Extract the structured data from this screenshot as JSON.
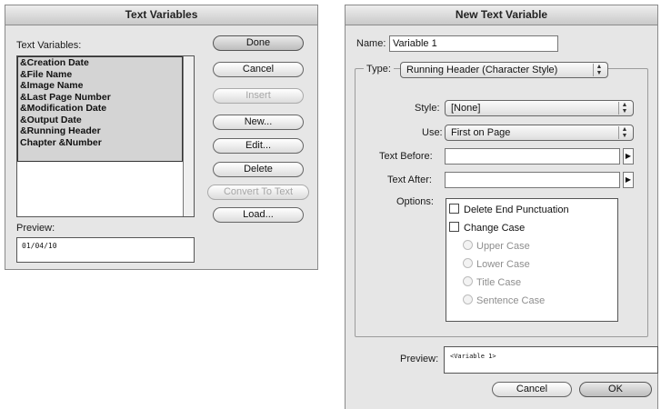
{
  "text_variables_dialog": {
    "title": "Text Variables",
    "list_label": "Text Variables:",
    "items": [
      "&Creation Date",
      "&File Name",
      "&Image Name",
      "&Last Page Number",
      "&Modification Date",
      "&Output Date",
      "&Running Header",
      "Chapter &Number"
    ],
    "preview_label": "Preview:",
    "preview_value": "01/04/10",
    "buttons": {
      "done": "Done",
      "cancel": "Cancel",
      "insert": "Insert",
      "new": "New...",
      "edit": "Edit...",
      "delete": "Delete",
      "convert": "Convert To Text",
      "load": "Load..."
    }
  },
  "new_text_variable_dialog": {
    "title": "New Text Variable",
    "name_label": "Name:",
    "name_value": "Variable 1",
    "type_label": "Type:",
    "type_value": "Running Header (Character Style)",
    "style_label": "Style:",
    "style_value": "[None]",
    "use_label": "Use:",
    "use_value": "First on Page",
    "text_before_label": "Text Before:",
    "text_before_value": "",
    "text_after_label": "Text After:",
    "text_after_value": "",
    "options_label": "Options:",
    "options": {
      "delete_end_punctuation": "Delete End Punctuation",
      "change_case": "Change Case",
      "upper_case": "Upper Case",
      "lower_case": "Lower Case",
      "title_case": "Title Case",
      "sentence_case": "Sentence Case"
    },
    "preview_label": "Preview:",
    "preview_value": "<Variable 1>",
    "buttons": {
      "cancel": "Cancel",
      "ok": "OK"
    }
  }
}
